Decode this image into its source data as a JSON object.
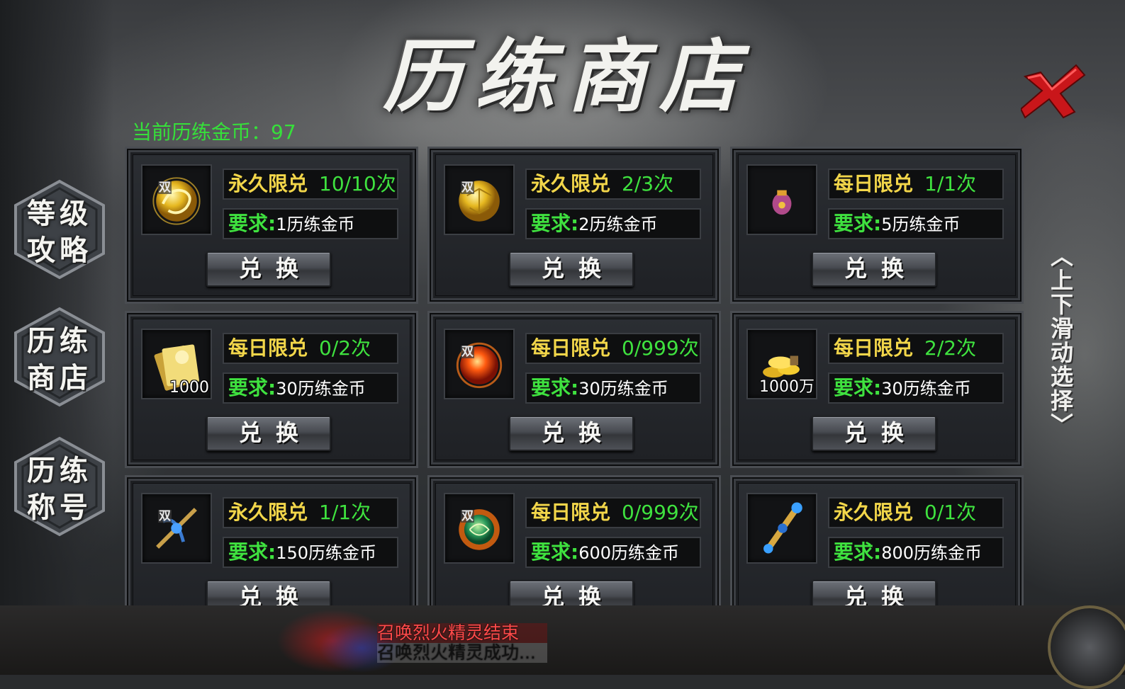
{
  "title": "历练商店",
  "currency": {
    "label": "当前历练金币：",
    "value": "97"
  },
  "side_menu": [
    {
      "line1": "等级",
      "line2": "攻略"
    },
    {
      "line1": "历练",
      "line2": "商店"
    },
    {
      "line1": "历练",
      "line2": "称号"
    }
  ],
  "scroll_hint": {
    "arrow_up": "︿",
    "text": [
      "上",
      "下",
      "滑",
      "动",
      "选",
      "择"
    ],
    "arrow_down": "﹀"
  },
  "exchange_label": "兑换",
  "req_label": "要求:",
  "bind_tag": "双",
  "items": [
    {
      "limit_type": "永久限兑",
      "count": "10/10次",
      "cost": "1历练金币",
      "icon": "gold-dragon-icon",
      "bound": true,
      "qty": ""
    },
    {
      "limit_type": "永久限兑",
      "count": "2/3次",
      "cost": "2历练金币",
      "icon": "gold-orb-icon",
      "bound": true,
      "qty": ""
    },
    {
      "limit_type": "每日限兑",
      "count": "1/1次",
      "cost": "5历练金币",
      "icon": "pouch-icon",
      "bound": false,
      "qty": ""
    },
    {
      "limit_type": "每日限兑",
      "count": "0/2次",
      "cost": "30历练金币",
      "icon": "scroll-bundle-icon",
      "bound": false,
      "qty": "1000"
    },
    {
      "limit_type": "每日限兑",
      "count": "0/999次",
      "cost": "30历练金币",
      "icon": "fire-orb-icon",
      "bound": true,
      "qty": ""
    },
    {
      "limit_type": "每日限兑",
      "count": "2/2次",
      "cost": "30历练金币",
      "icon": "gold-coins-icon",
      "bound": false,
      "qty": "1000万"
    },
    {
      "limit_type": "永久限兑",
      "count": "1/1次",
      "cost": "150历练金币",
      "icon": "crossbow-icon",
      "bound": true,
      "qty": ""
    },
    {
      "limit_type": "每日限兑",
      "count": "0/999次",
      "cost": "600历练金币",
      "icon": "jade-orb-icon",
      "bound": true,
      "qty": ""
    },
    {
      "limit_type": "永久限兑",
      "count": "0/1次",
      "cost": "800历练金币",
      "icon": "scepter-icon",
      "bound": false,
      "qty": ""
    }
  ],
  "chat": [
    {
      "text": "召唤烈火精灵结束"
    },
    {
      "text": "召唤烈火精灵成功..."
    }
  ],
  "colors": {
    "green": "#3fe23f",
    "yellow": "#f2d64a",
    "close_red": "#d41a1a"
  }
}
